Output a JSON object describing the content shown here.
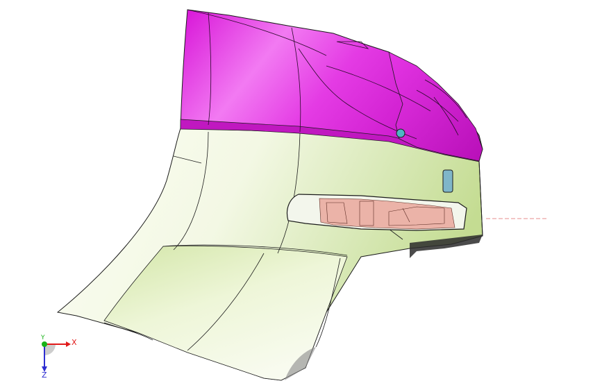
{
  "viewport": {
    "triad": {
      "x_label": "X",
      "y_label": "Y",
      "z_label": "Z",
      "x_color": "#e11a1a",
      "y_color": "#19b319",
      "z_color": "#2d2dd1"
    },
    "colors": {
      "roof": "#e61ee6",
      "body": "#eef6dd",
      "body_shade": "#c8df97",
      "edges": "#1a1a1a",
      "interior": "#e8b1a6",
      "window": "#7fb6c9"
    }
  }
}
